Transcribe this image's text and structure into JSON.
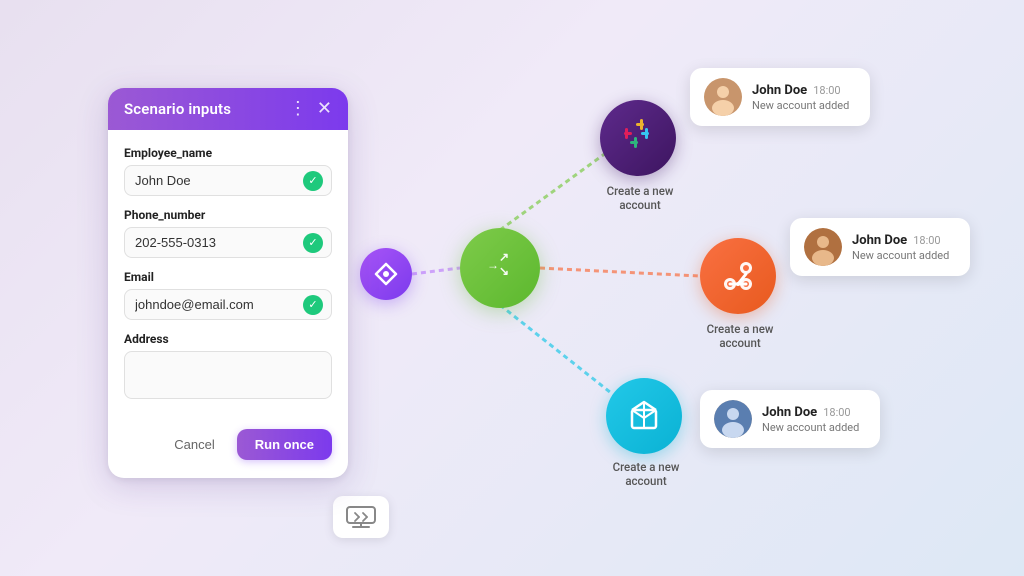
{
  "modal": {
    "title": "Scenario inputs",
    "fields": [
      {
        "label": "Employee_name",
        "value": "John Doe",
        "placeholder": "John Doe",
        "hasCheck": true,
        "name": "employee-name-field"
      },
      {
        "label": "Phone_number",
        "value": "202-555-0313",
        "placeholder": "202-555-0313",
        "hasCheck": true,
        "name": "phone-number-field"
      },
      {
        "label": "Email",
        "value": "johndoe@email.com",
        "placeholder": "johndoe@email.com",
        "hasCheck": true,
        "name": "email-field"
      },
      {
        "label": "Address",
        "value": "",
        "placeholder": "",
        "hasCheck": false,
        "name": "address-field"
      }
    ],
    "cancel_label": "Cancel",
    "run_label": "Run once"
  },
  "workflow": {
    "nodes": {
      "slack_label": "Create a new account",
      "hubspot_label": "Create a new account",
      "box_label": "Create a new account"
    },
    "notifications": [
      {
        "name": "John Doe",
        "time": "18:00",
        "message": "New account added"
      },
      {
        "name": "John Doe",
        "time": "18:00",
        "message": "New account added"
      },
      {
        "name": "John Doe",
        "time": "18:00",
        "message": "New account added"
      }
    ]
  }
}
